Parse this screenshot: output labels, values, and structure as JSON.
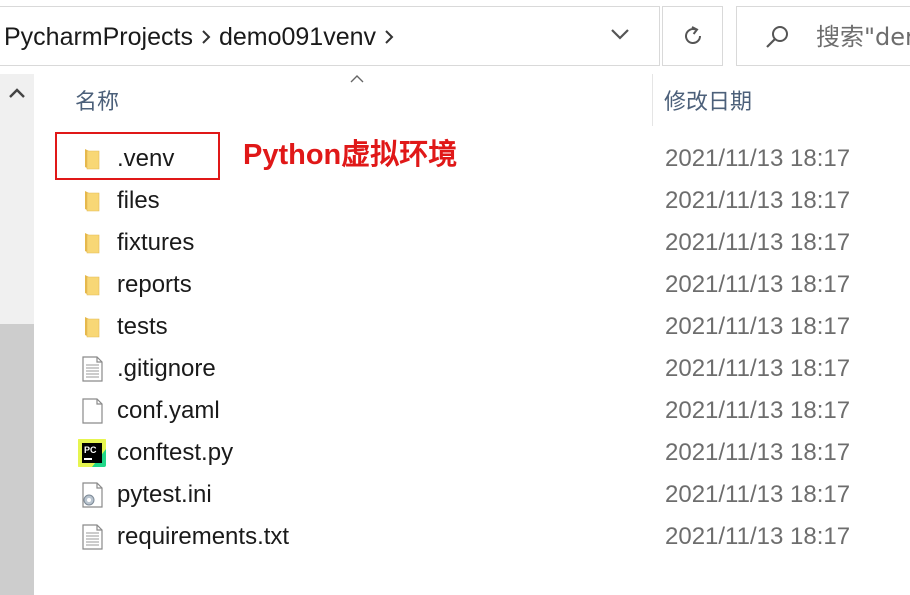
{
  "address_bar": {
    "crumbs": [
      "PycharmProjects",
      "demo091venv"
    ],
    "separator_icon": "chevron-right-icon",
    "dropdown_icon": "chevron-down-icon"
  },
  "refresh": {
    "icon": "refresh-icon"
  },
  "search": {
    "placeholder": "搜索\"der",
    "icon": "search-icon"
  },
  "columns": {
    "name": "名称",
    "date_modified": "修改日期"
  },
  "annotation": {
    "text": "Python虚拟环境",
    "color": "#e01818"
  },
  "files": [
    {
      "name": ".venv",
      "type": "folder",
      "date": "2021/11/13 18:17"
    },
    {
      "name": "files",
      "type": "folder",
      "date": "2021/11/13 18:17"
    },
    {
      "name": "fixtures",
      "type": "folder",
      "date": "2021/11/13 18:17"
    },
    {
      "name": "reports",
      "type": "folder",
      "date": "2021/11/13 18:17"
    },
    {
      "name": "tests",
      "type": "folder",
      "date": "2021/11/13 18:17"
    },
    {
      "name": ".gitignore",
      "type": "text-file",
      "date": "2021/11/13 18:17"
    },
    {
      "name": "conf.yaml",
      "type": "blank-file",
      "date": "2021/11/13 18:17"
    },
    {
      "name": "conftest.py",
      "type": "pycharm-file",
      "date": "2021/11/13 18:17"
    },
    {
      "name": "pytest.ini",
      "type": "settings-file",
      "date": "2021/11/13 18:17"
    },
    {
      "name": "requirements.txt",
      "type": "text-file",
      "date": "2021/11/13 18:17"
    }
  ],
  "colors": {
    "header_text": "#4c607a",
    "date_text": "#6d6d6d",
    "folder": "#f8d775"
  }
}
